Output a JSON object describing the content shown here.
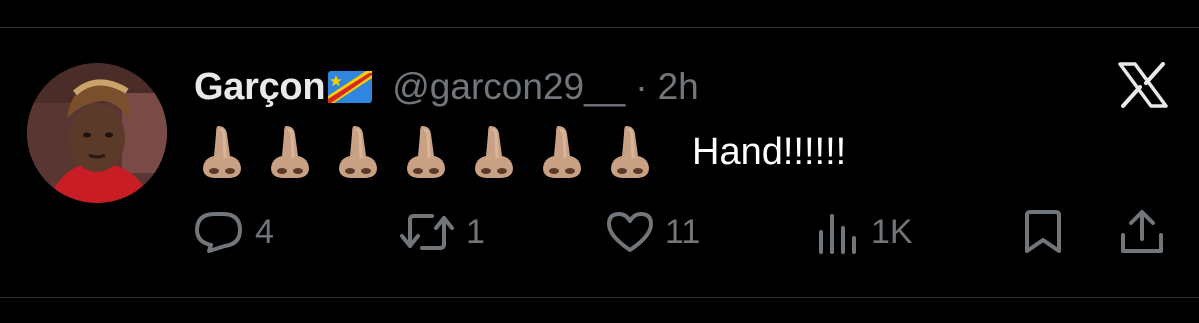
{
  "tweet": {
    "display_name": "Garçon",
    "handle": "@garcon29__",
    "separator": "·",
    "time": "2h",
    "emojis": [
      "nose-emoji",
      "nose-emoji",
      "nose-emoji",
      "nose-emoji",
      "nose-emoji",
      "nose-emoji",
      "nose-emoji"
    ],
    "text": "Hand!!!!!!"
  },
  "actions": {
    "replies": "4",
    "retweets": "1",
    "likes": "11",
    "views": "1K"
  },
  "colors": {
    "background": "#000000",
    "primary_text": "#e7e9ea",
    "secondary_text": "#71767b",
    "divider": "#2f3336"
  },
  "icons": [
    "reply-icon",
    "retweet-icon",
    "like-icon",
    "views-icon",
    "bookmark-icon",
    "share-icon",
    "x-logo-icon",
    "drc-flag-icon"
  ]
}
